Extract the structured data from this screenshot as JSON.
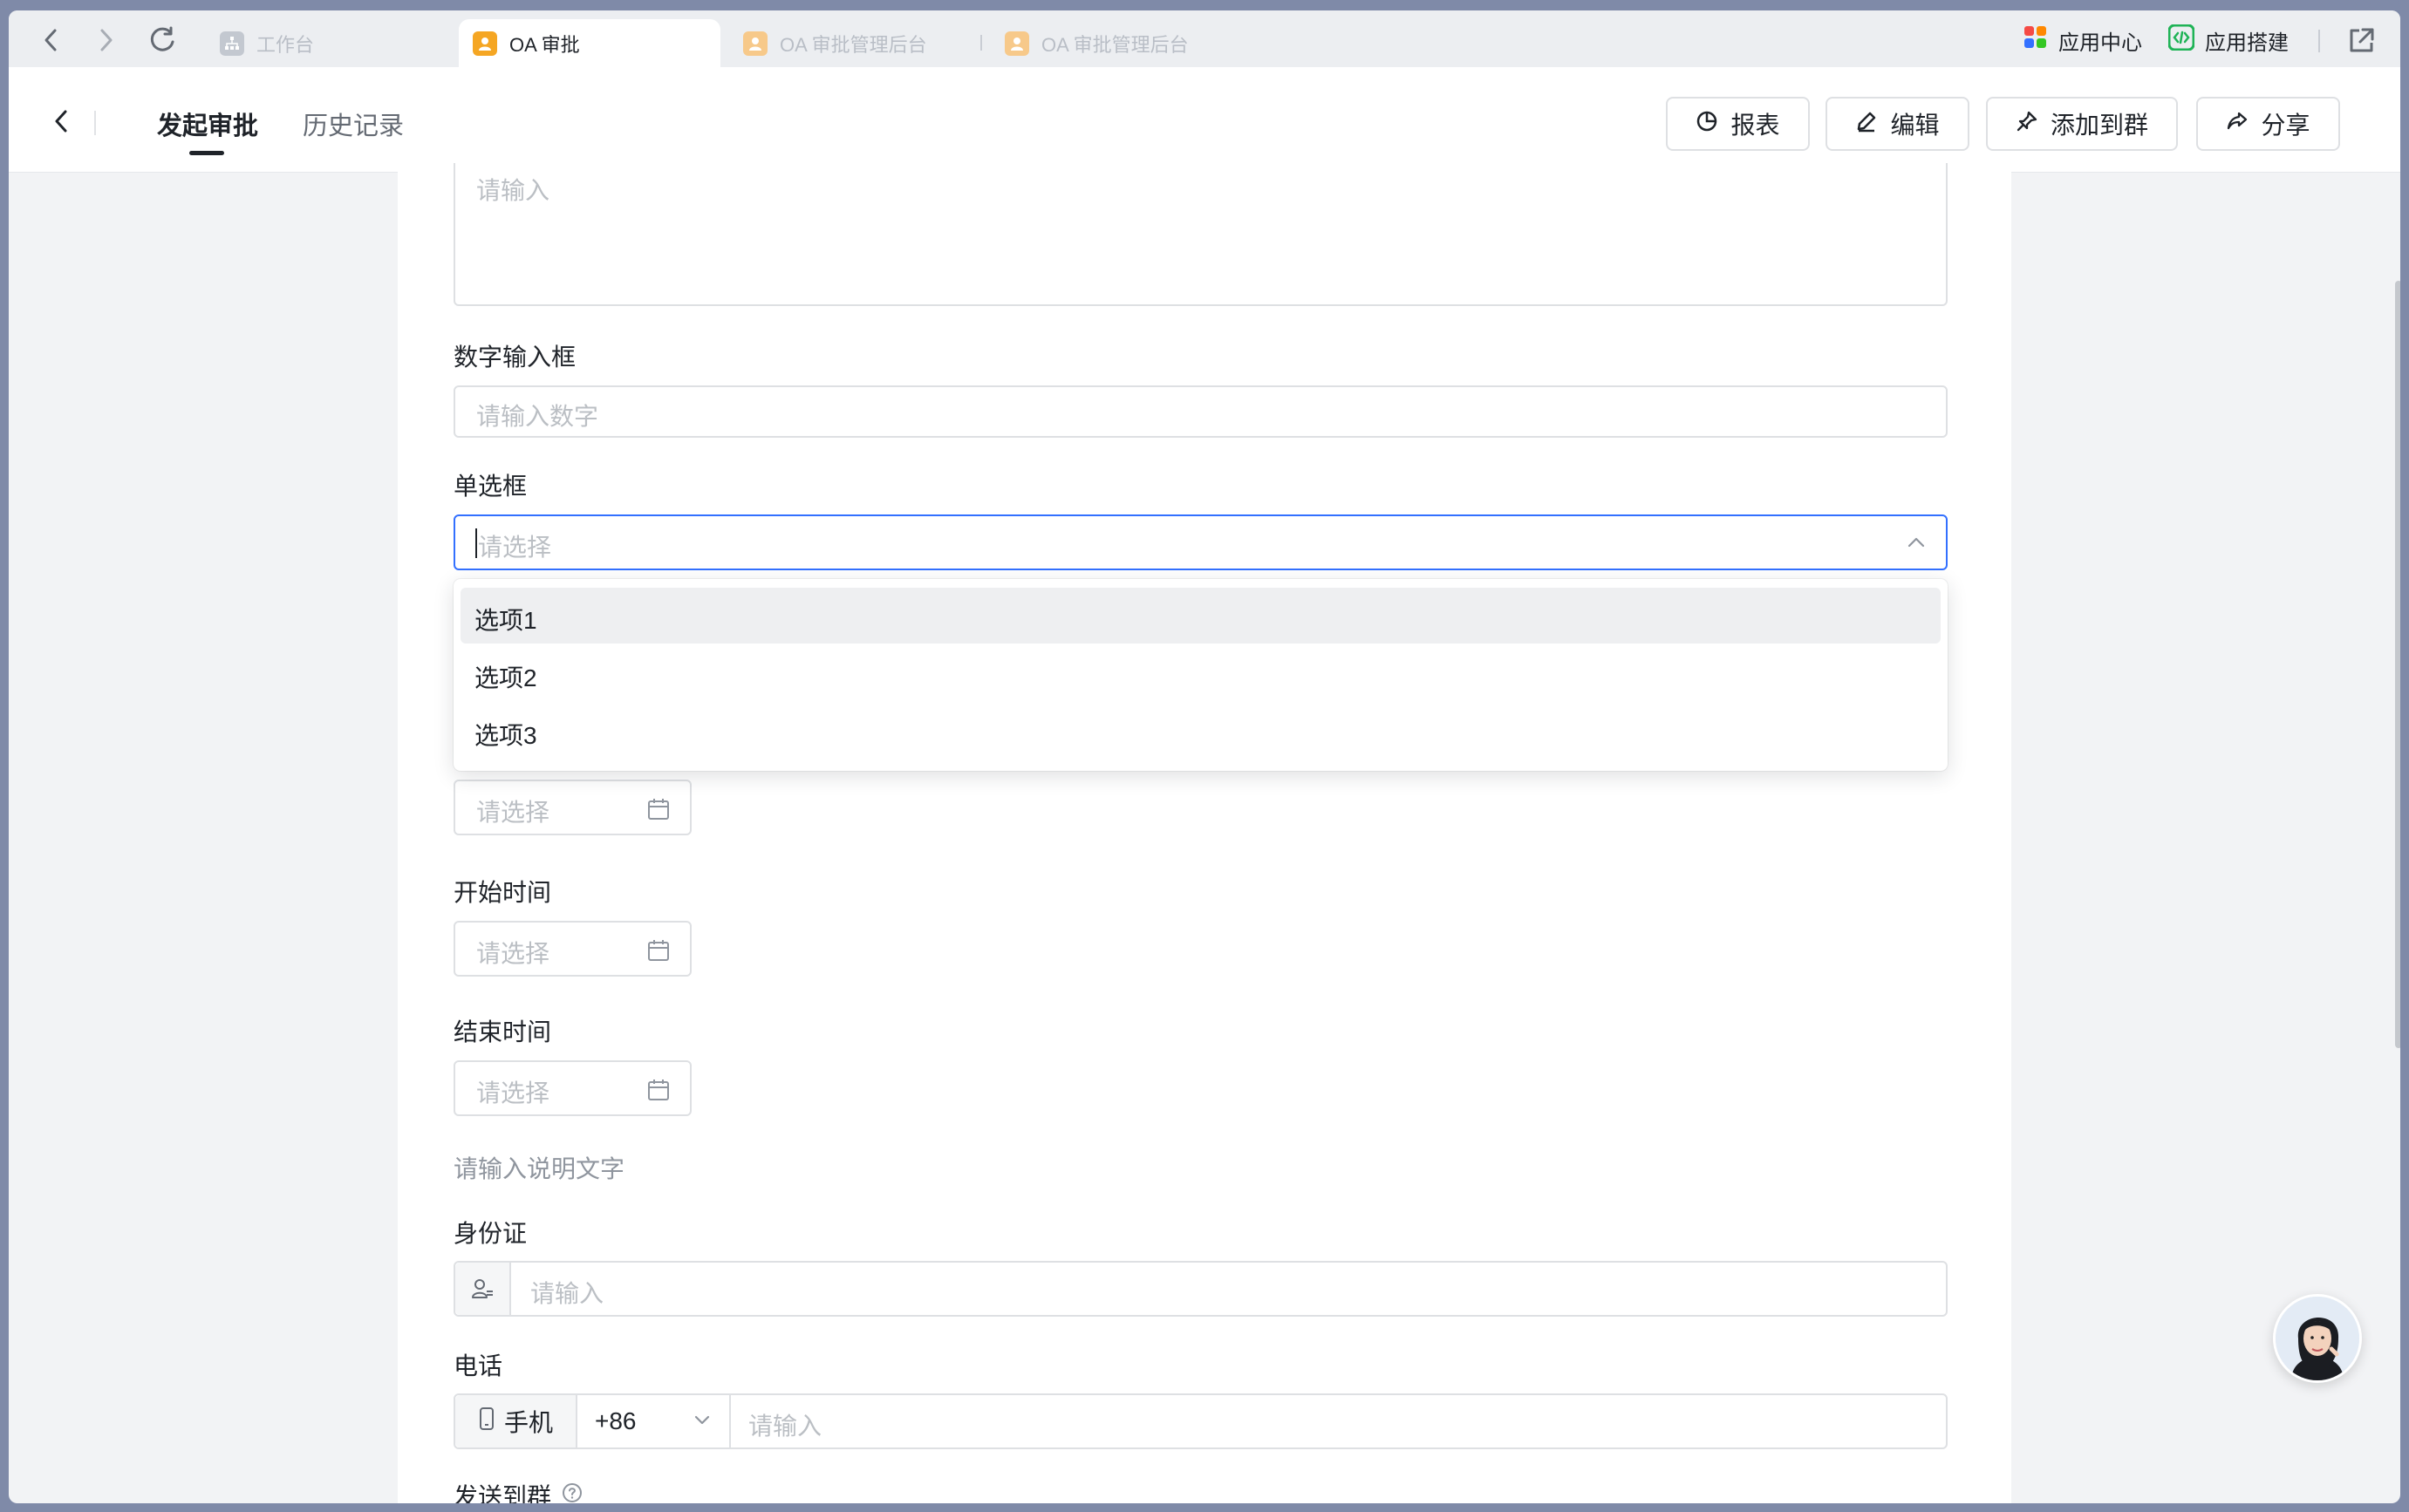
{
  "browser": {
    "tabs": [
      {
        "label": "工作台",
        "active": false
      },
      {
        "label": "OA 审批",
        "active": true
      },
      {
        "label": "OA 审批管理后台",
        "active": false
      },
      {
        "label": "OA 审批管理后台",
        "active": false
      }
    ],
    "app_center": "应用中心",
    "app_builder": "应用搭建"
  },
  "header": {
    "tabs": [
      {
        "label": "发起审批",
        "active": true
      },
      {
        "label": "历史记录",
        "active": false
      }
    ],
    "buttons": {
      "report": "报表",
      "edit": "编辑",
      "add_to_group": "添加到群",
      "share": "分享"
    }
  },
  "form": {
    "textarea_placeholder": "请输入",
    "number": {
      "label": "数字输入框",
      "placeholder": "请输入数字"
    },
    "radio": {
      "label": "单选框",
      "placeholder": "请选择",
      "options": [
        "选项1",
        "选项2",
        "选项3"
      ],
      "hovered_option": "选项1"
    },
    "date": {
      "placeholder": "请选择"
    },
    "start_time": {
      "label": "开始时间",
      "placeholder": "请选择"
    },
    "end_time": {
      "label": "结束时间",
      "placeholder": "请选择"
    },
    "description_text": "请输入说明文字",
    "id_card": {
      "label": "身份证",
      "placeholder": "请输入"
    },
    "phone": {
      "label": "电话",
      "type": "手机",
      "country_code": "+86",
      "placeholder": "请输入"
    },
    "send_to_group": {
      "label": "发送到群"
    }
  },
  "colors": {
    "focus_border": "#3370ff",
    "text_primary": "#1f2329",
    "placeholder": "#bbbfc4",
    "tab_fav": "#f5a623",
    "app_builder_green": "#1fb356"
  }
}
